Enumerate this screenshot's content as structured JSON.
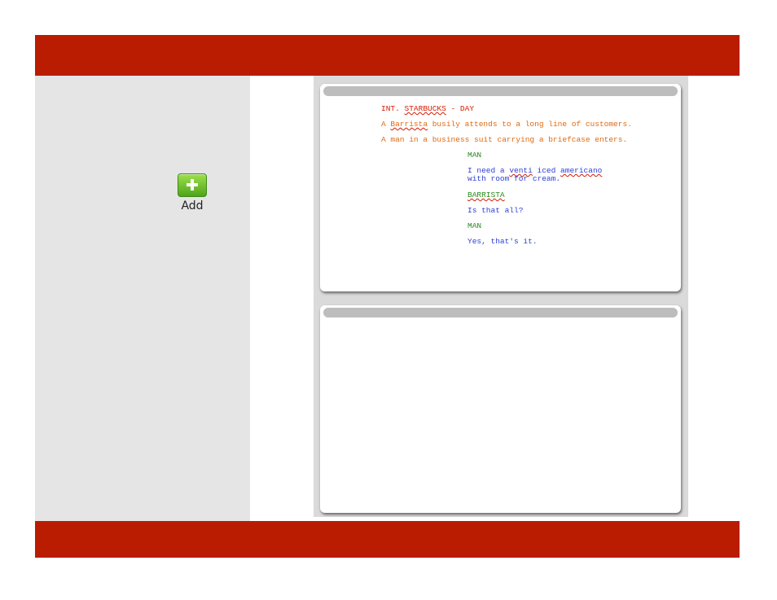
{
  "sidebar": {
    "add_label": "Add"
  },
  "script": {
    "scene_heading": {
      "prefix": "INT. ",
      "location": "STARBUCKS",
      "suffix": " - DAY"
    },
    "action1": {
      "prefix": "A ",
      "word": "Barrista",
      "suffix": " busily attends to a long line of customers."
    },
    "action2": "A man in a business suit carrying a briefcase enters.",
    "char1": "MAN",
    "dialogue1": {
      "l1_prefix": "I need a ",
      "l1_word1": "venti",
      "l1_mid": " iced ",
      "l1_word2": "americano",
      "l2": "with room for cream."
    },
    "char2": "BARRISTA",
    "dialogue2": "Is that all?",
    "char3": "MAN",
    "dialogue3": "Yes, that's it."
  },
  "colors": {
    "brand_red": "#b91c00",
    "scene_heading": "#d61c00",
    "action": "#e06a10",
    "character": "#2a8a1e",
    "dialogue": "#2b3fd4"
  }
}
